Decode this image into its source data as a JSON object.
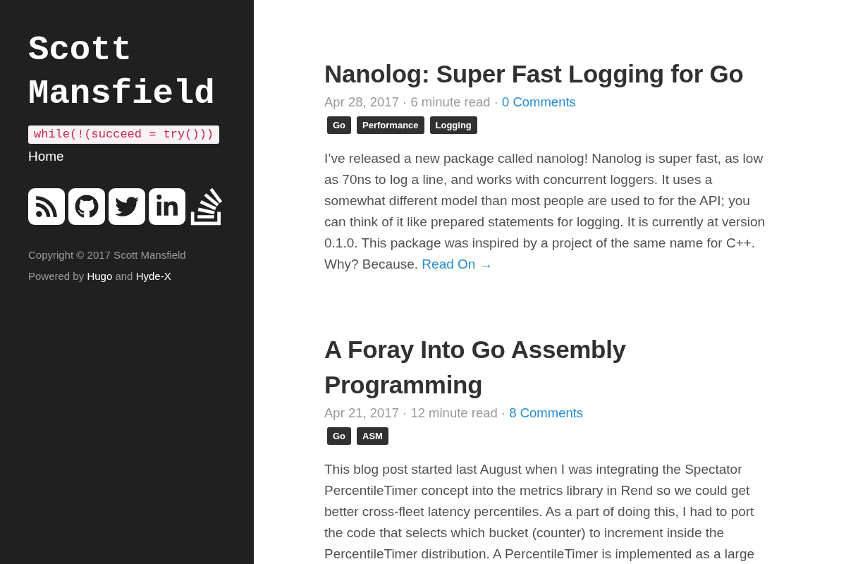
{
  "sidebar": {
    "site_title": "Scott Mansfield",
    "tagline": "while(!(succeed = try()))",
    "nav": [
      {
        "label": "Home"
      }
    ],
    "social_links": [
      {
        "kind": "rss"
      },
      {
        "kind": "github"
      },
      {
        "kind": "twitter"
      },
      {
        "kind": "linkedin"
      },
      {
        "kind": "stackoverflow"
      }
    ],
    "copyright": "Copyright © 2017 Scott Mansfield",
    "powered_by": [
      {
        "kind": "text",
        "text": "Powered by"
      },
      {
        "kind": "link",
        "text": "Hugo"
      },
      {
        "kind": "text",
        "text": "and"
      },
      {
        "kind": "link",
        "text": "Hyde-X"
      }
    ]
  },
  "posts": [
    {
      "title": "Nanolog: Super Fast Logging for Go",
      "meta": "Apr 28, 2017 · 6 minute read ·",
      "comments": "0 Comments",
      "tags": [
        "Go",
        "Performance",
        "Logging"
      ],
      "excerpt": "I’ve released a new package called nanolog! Nanolog is super fast, as low as 70ns to log a line, and works with concurrent loggers. It uses a somewhat different model than most people are used to for the API; you can think of it like prepared statements for logging. It is currently at version 0.1.0. This package was inspired by a project of the same name for C++. Why? Because.",
      "read_more": "Read On →"
    },
    {
      "title": "A Foray Into Go Assembly Programming",
      "meta": "Apr 21, 2017 · 12 minute read ·",
      "comments": "8 Comments",
      "tags": [
        "Go",
        "ASM"
      ],
      "excerpt": "This blog post started last August when I was integrating the Spectator PercentileTimer concept into the metrics library in Rend so we could get better cross-fleet latency percentiles. As a part of doing this, I had to port the code that selects which bucket (counter) to increment inside the PercentileTimer distribution. A PercentileTimer is implemented as a large"
    }
  ]
}
